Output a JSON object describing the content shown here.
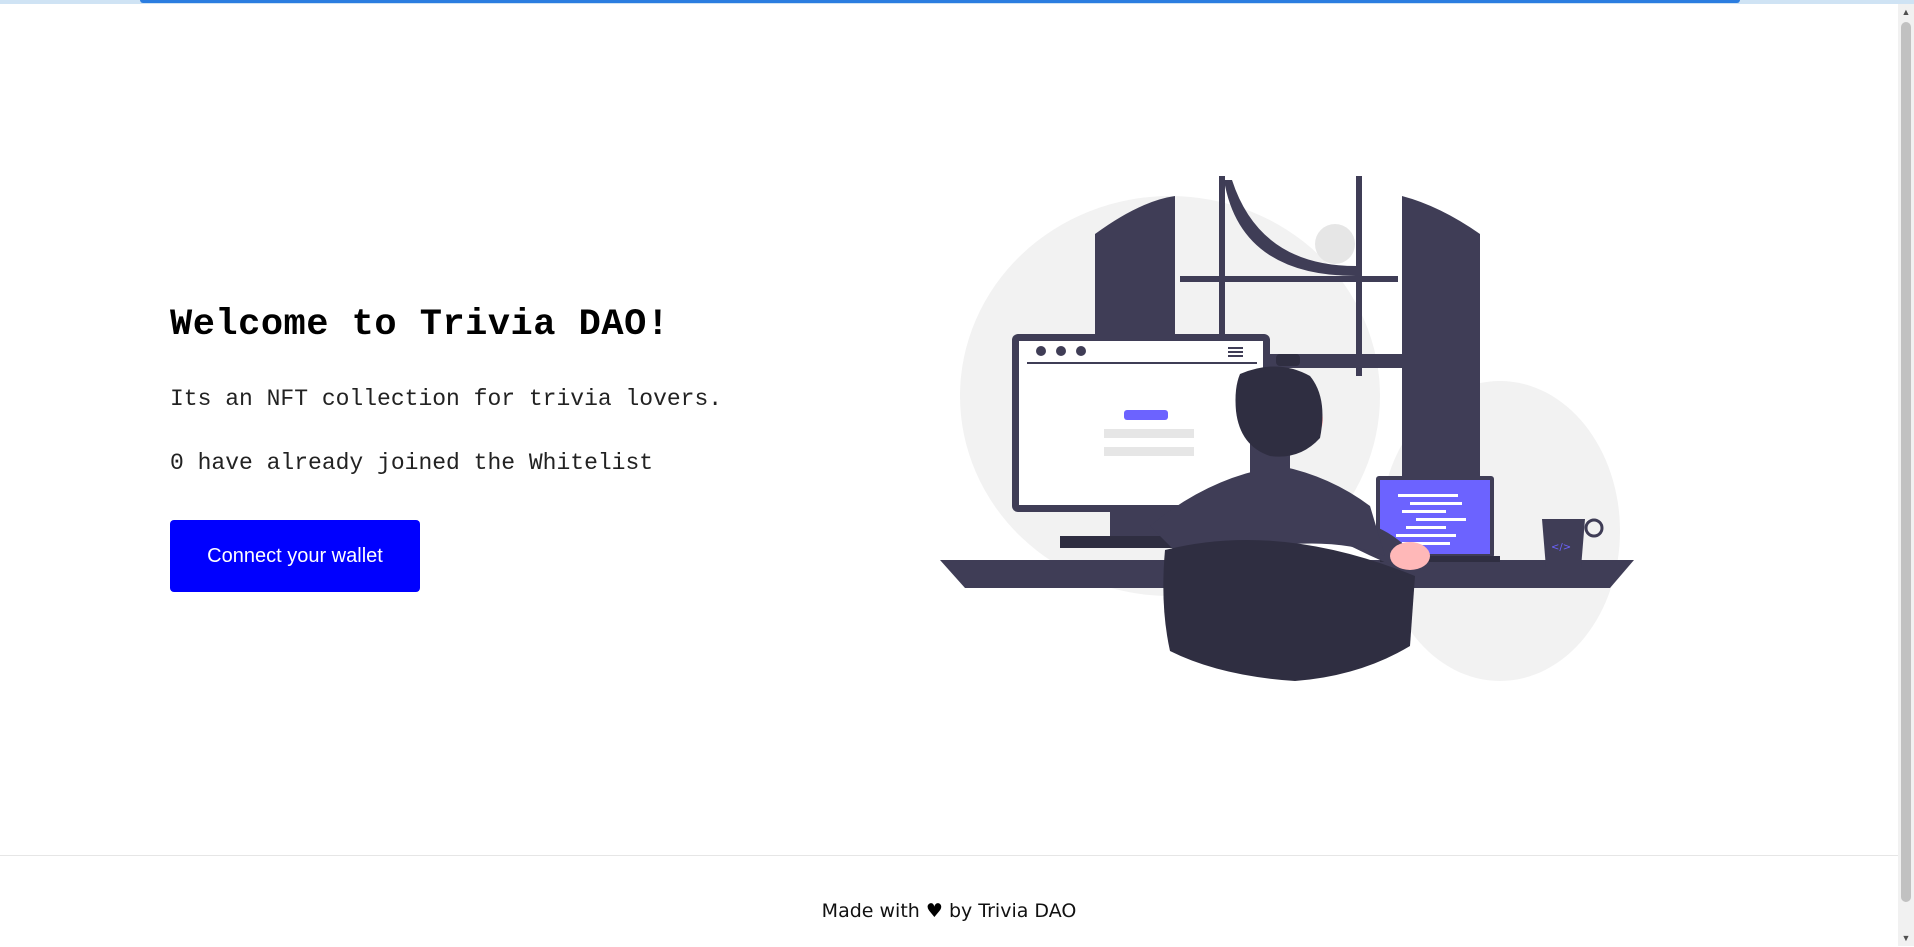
{
  "hero": {
    "title": "Welcome to Trivia DAO!",
    "description": "Its an NFT collection for trivia lovers.",
    "whitelist_status": "0 have already joined the Whitelist",
    "connect_button_label": "Connect your wallet"
  },
  "footer": {
    "prefix": "Made with",
    "heart": "♥",
    "suffix": "by Trivia DAO"
  },
  "colors": {
    "accent": "#0000ff",
    "illustration_primary": "#3f3d56",
    "illustration_accent": "#6c63ff"
  },
  "icons": {
    "footer_heart": "heart-icon",
    "scroll_up": "chevron-up-icon",
    "scroll_down": "chevron-down-icon"
  }
}
